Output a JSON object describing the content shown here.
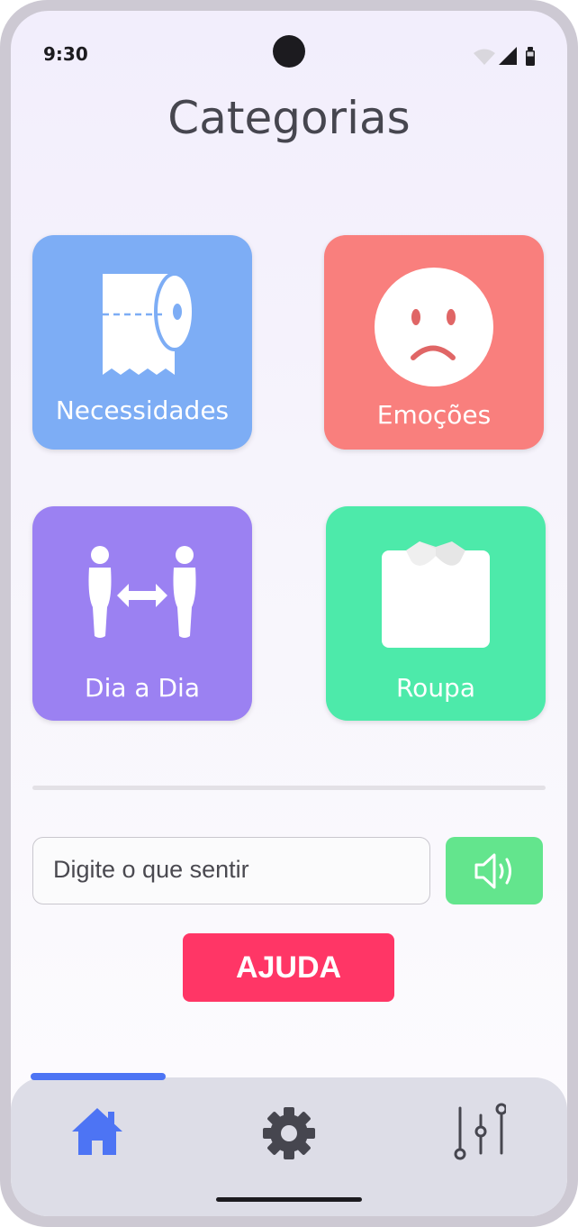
{
  "status_bar": {
    "time": "9:30"
  },
  "page": {
    "title": "Categorias"
  },
  "categories": [
    {
      "label": "Necessidades",
      "color": "#7dadf5",
      "icon": "toilet-paper-icon"
    },
    {
      "label": "Emoções",
      "color": "#f97f7d",
      "icon": "sad-face-icon"
    },
    {
      "label": "Dia a Dia",
      "color": "#9b81f2",
      "icon": "people-interaction-icon"
    },
    {
      "label": "Roupa",
      "color": "#4deaaa",
      "icon": "shirt-icon"
    }
  ],
  "input": {
    "placeholder": "Digite o que sentir",
    "value": ""
  },
  "speak_button": {
    "icon": "speaker-icon",
    "color": "#63e58d"
  },
  "help_button": {
    "label": "AJUDA",
    "color": "#ff3666"
  },
  "bottom_nav": {
    "items": [
      {
        "icon": "home-icon",
        "active": true,
        "color": "#4d74f4"
      },
      {
        "icon": "gear-icon",
        "active": false,
        "color": "#46464f"
      },
      {
        "icon": "sliders-icon",
        "active": false,
        "color": "#46464f"
      }
    ]
  }
}
